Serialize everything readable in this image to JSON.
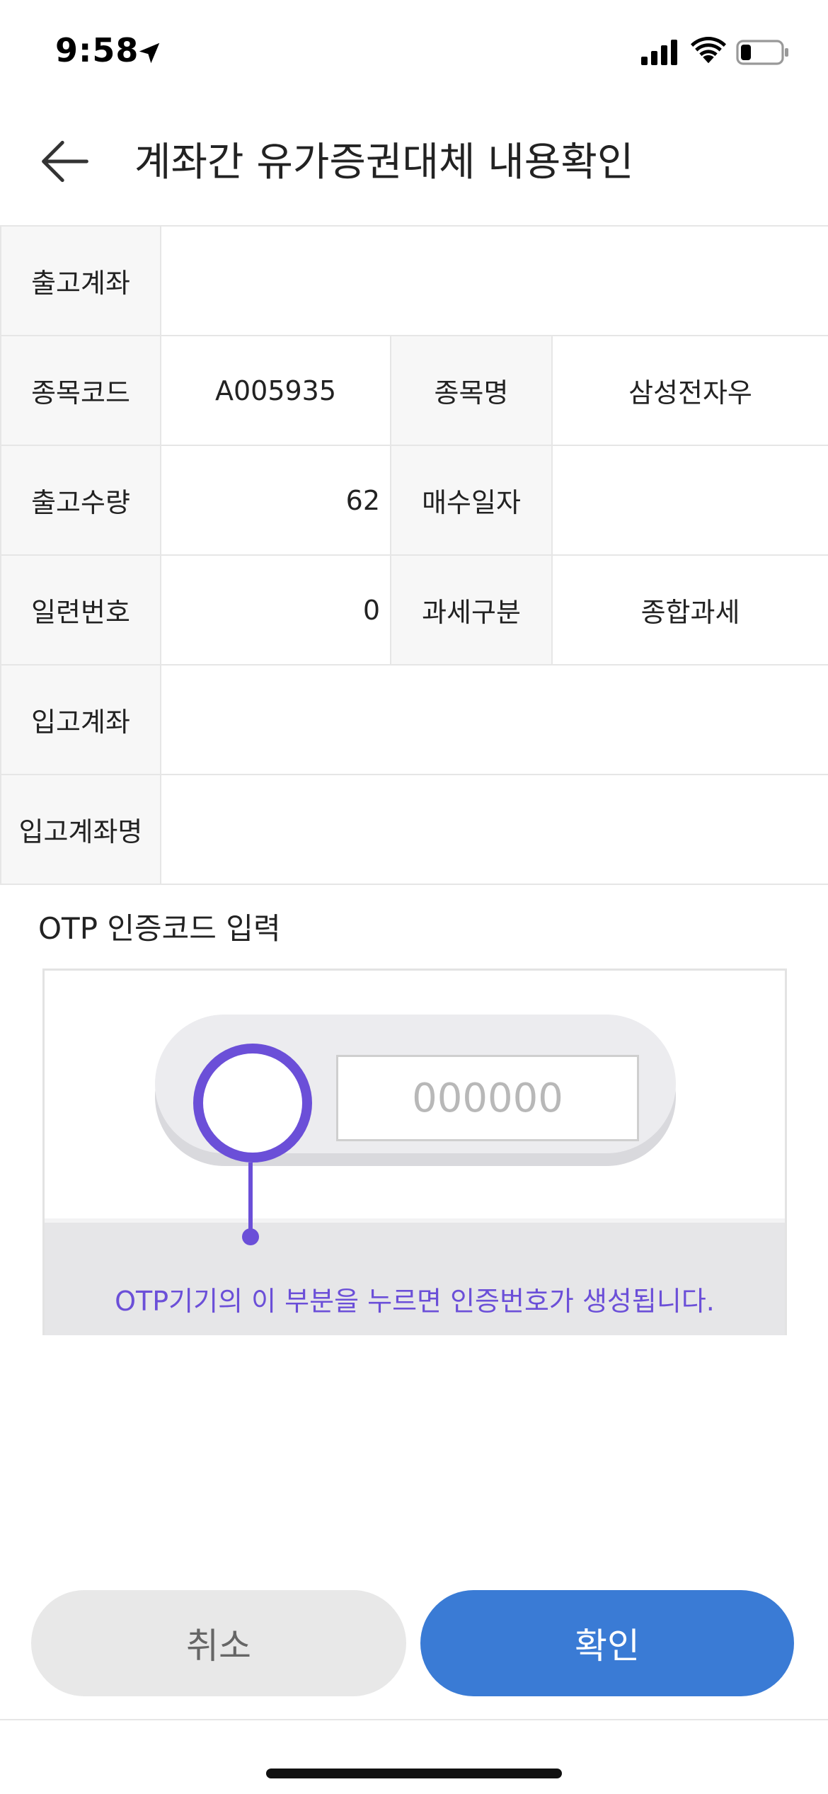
{
  "status_bar": {
    "time": "9:58",
    "icons": [
      "location-arrow-icon",
      "signal-icon",
      "wifi-icon",
      "battery-icon"
    ]
  },
  "header": {
    "back_icon": "arrow-left-icon",
    "title": "계좌간 유가증권대체 내용확인"
  },
  "table": {
    "out_account_label": "출고계좌",
    "out_account_value": "",
    "stock_code_label": "종목코드",
    "stock_code_value": "A005935",
    "stock_name_label": "종목명",
    "stock_name_value": "삼성전자우",
    "out_qty_label": "출고수량",
    "out_qty_value": "62",
    "buy_date_label": "매수일자",
    "buy_date_value": "",
    "serial_label": "일련번호",
    "serial_value": "0",
    "tax_type_label": "과세구분",
    "tax_type_value": "종합과세",
    "in_account_label": "입고계좌",
    "in_account_value": "",
    "in_account_name_label": "입고계좌명",
    "in_account_name_value": ""
  },
  "otp": {
    "label": "OTP 인증코드 입력",
    "placeholder": "000000",
    "hint": "OTP기기의 이 부분을 누르면 인증번호가 생성됩니다."
  },
  "buttons": {
    "cancel": "취소",
    "confirm": "확인"
  },
  "colors": {
    "accent_purple": "#6b4fd8",
    "confirm_blue": "#3a7bd5",
    "cancel_gray": "#e8e8e8"
  }
}
